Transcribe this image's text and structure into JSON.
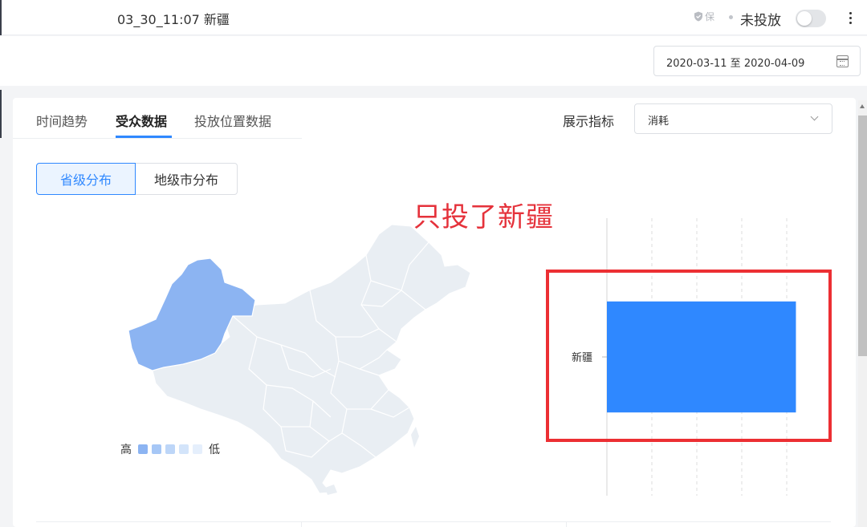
{
  "header": {
    "campaign_title": "03_30_11:07 新疆",
    "badge_label": "保",
    "status_label": "未投放",
    "toggle_on": false
  },
  "date_range": {
    "value": "2020-03-11 至 2020-04-09"
  },
  "tabs": [
    {
      "label": "时间趋势",
      "active": false
    },
    {
      "label": "受众数据",
      "active": true
    },
    {
      "label": "投放位置数据",
      "active": false
    }
  ],
  "metric": {
    "label": "展示指标",
    "selected": "消耗"
  },
  "region_toggle": [
    {
      "label": "省级分布",
      "active": true
    },
    {
      "label": "地级市分布",
      "active": false
    }
  ],
  "annotation": "只投了新疆",
  "legend": {
    "high": "高",
    "low": "低",
    "colors": [
      "#8cb4f2",
      "#a6c7f6",
      "#bdd6f8",
      "#d3e4fa",
      "#e5effc"
    ]
  },
  "colors": {
    "accent": "#2f88ff",
    "map_base": "#e9eef3",
    "map_highlight": "#8cb4f2",
    "annotation": "#e5323b"
  },
  "chart_data": {
    "type": "bar",
    "orientation": "horizontal",
    "categories": [
      "新疆"
    ],
    "series": [
      {
        "values": [
          1
        ]
      }
    ],
    "color": "#2f88ff",
    "xlim": [
      0,
      1.1
    ],
    "grid": true
  }
}
